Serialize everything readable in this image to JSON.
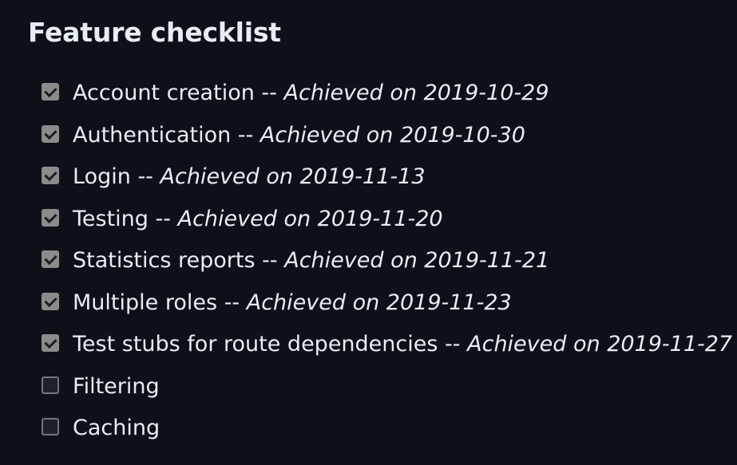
{
  "heading": "Feature checklist",
  "items": [
    {
      "label": "Account creation",
      "separator": "--",
      "note": "Achieved on 2019-10-29",
      "checked": true
    },
    {
      "label": "Authentication",
      "separator": "--",
      "note": "Achieved on 2019-10-30",
      "checked": true
    },
    {
      "label": "Login",
      "separator": "--",
      "note": "Achieved on 2019-11-13",
      "checked": true
    },
    {
      "label": "Testing",
      "separator": "--",
      "note": "Achieved on 2019-11-20",
      "checked": true
    },
    {
      "label": "Statistics reports",
      "separator": "--",
      "note": "Achieved on 2019-11-21",
      "checked": true
    },
    {
      "label": "Multiple roles",
      "separator": "--",
      "note": "Achieved on 2019-11-23",
      "checked": true
    },
    {
      "label": "Test stubs for route dependencies",
      "separator": "--",
      "note": "Achieved on 2019-11-27",
      "checked": true
    },
    {
      "label": "Filtering",
      "checked": false
    },
    {
      "label": "Caching",
      "checked": false
    }
  ],
  "colors": {
    "background": "#0d1117",
    "text": "#e6edf3",
    "checkbox_checked": "#8b8b8b",
    "checkbox_unchecked_border": "#6e7681"
  }
}
